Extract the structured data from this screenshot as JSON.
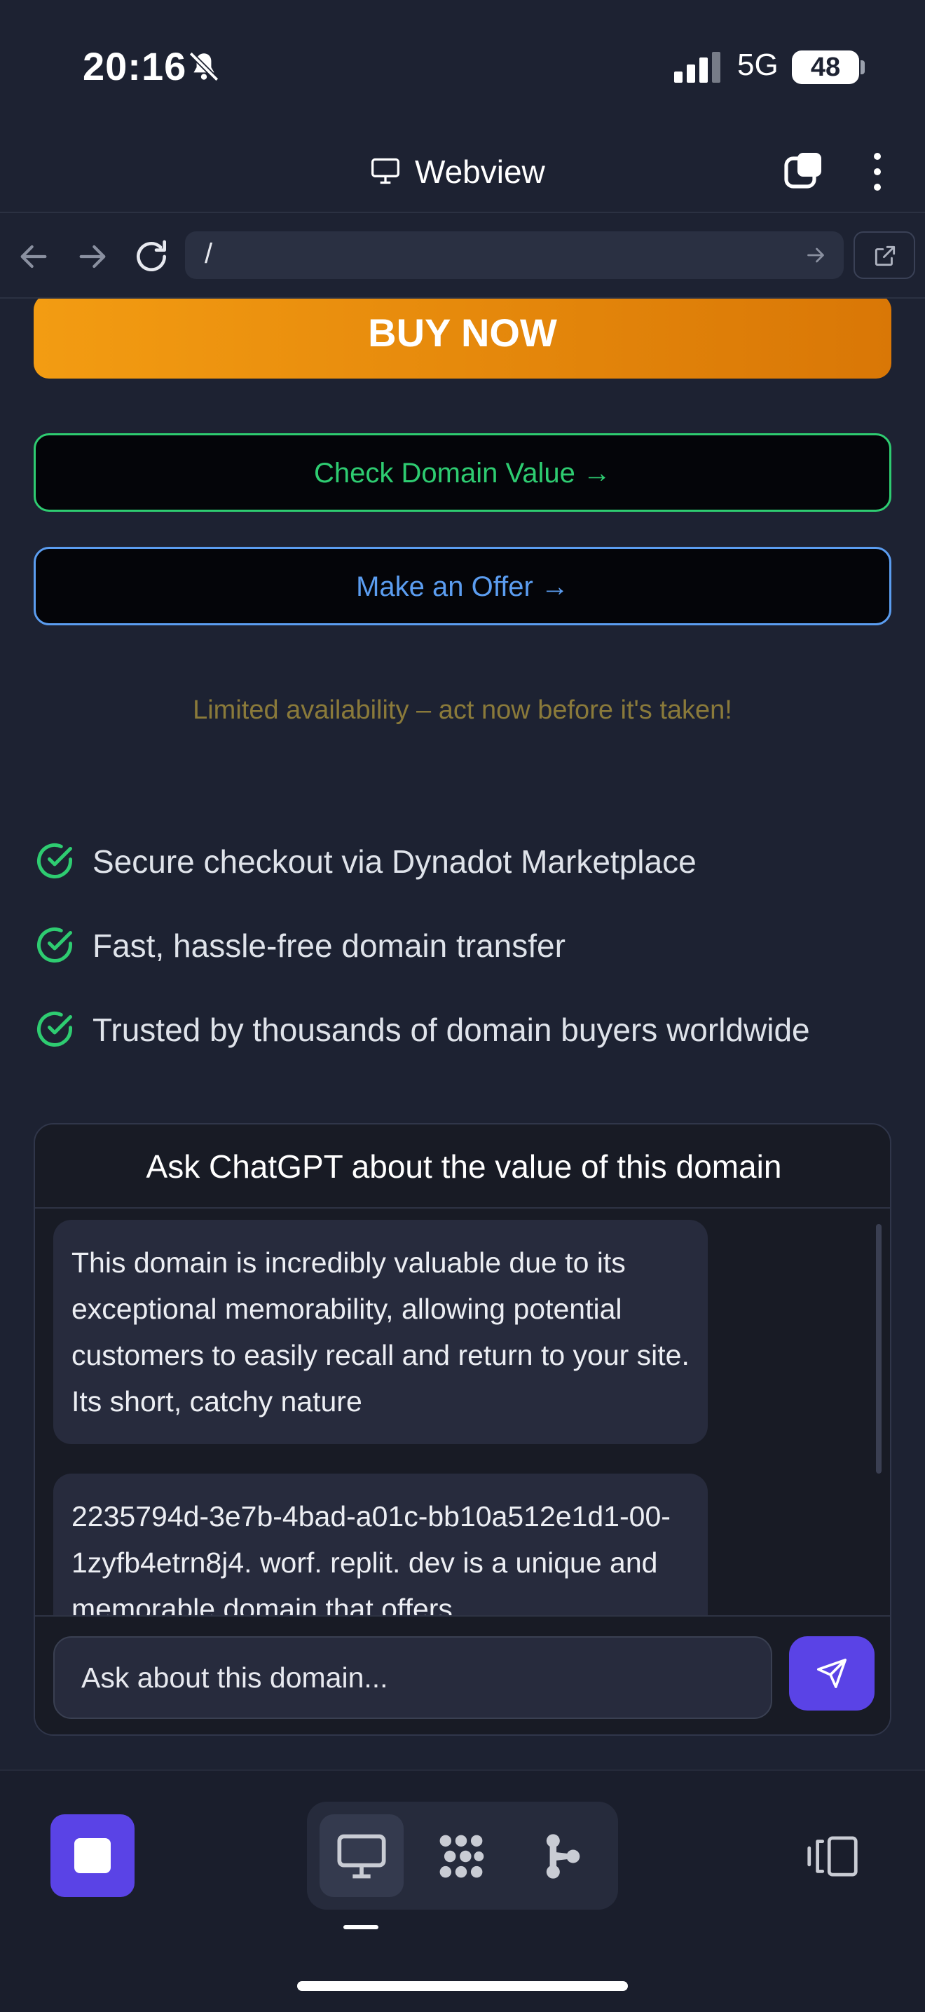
{
  "status_bar": {
    "time": "20:16",
    "network": "5G",
    "battery": "48"
  },
  "app_header": {
    "title": "Webview"
  },
  "url_bar": {
    "url": "/"
  },
  "page": {
    "buy_now": "BUY NOW",
    "check_value": "Check Domain Value →",
    "make_offer": "Make an Offer →",
    "limited_note": "Limited availability – act now before it's taken!",
    "features": [
      "Secure checkout via Dynadot Marketplace",
      "Fast, hassle-free domain transfer",
      "Trusted by thousands of domain buyers worldwide"
    ],
    "chat": {
      "title": "Ask ChatGPT about the value of this domain",
      "messages": [
        "This domain is incredibly valuable due to its exceptional memorability, allowing potential customers to easily recall and return to your site. Its short, catchy nature",
        "2235794d-3e7b-4bad-a01c-bb10a512e1d1-00-1zyfb4etrn8j4. worf. replit. dev is a unique and memorable domain that offers"
      ],
      "input_placeholder": "Ask about this domain..."
    }
  },
  "colors": {
    "accent": "#5a43e6",
    "buy_gradient_start": "#f39c12",
    "buy_gradient_end": "#d97706",
    "green": "#2ecc71",
    "blue": "#5b9df0"
  }
}
